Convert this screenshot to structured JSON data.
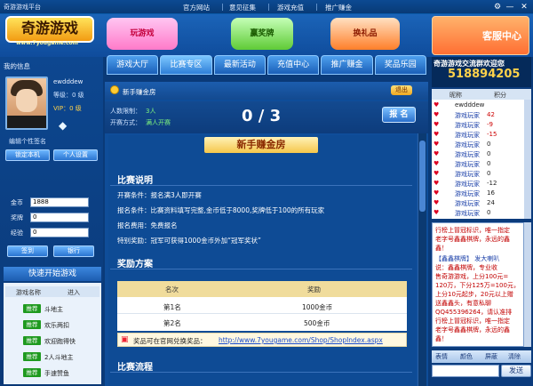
{
  "window": {
    "title": "奇游游戏平台",
    "minimize": "—",
    "close": "✕",
    "gear": "⚙"
  },
  "toplinks": [
    "官方网站",
    "意见征集",
    "游戏充值",
    "推广赚金"
  ],
  "banner": {
    "logo": "奇游游戏",
    "logo_url": "www.7yougame.com",
    "promo1": "玩游戏",
    "promo2": "赢奖牌",
    "promo3": "换礼品",
    "service": "客服中心"
  },
  "nav": [
    "游戏大厅",
    "比赛专区",
    "最新活动",
    "充值中心",
    "推广赚金",
    "奖品乐园"
  ],
  "qq": {
    "title": "奇游游戏交流群欢迎您",
    "number": "518894205"
  },
  "user": {
    "section_title": "我的信息",
    "id": "ewdddew",
    "level": "等级：0 级",
    "vip": "VIP：0 级",
    "signature": "编辑个性签名",
    "lock_btn": "锁定本机",
    "settings_btn": "个人设置",
    "gold_label": "金币",
    "gold": "1888",
    "medal_label": "奖牌",
    "medal": "0",
    "exp_label": "经验",
    "exp": "0",
    "signin_btn": "签到",
    "bank_btn": "银行"
  },
  "quick": {
    "title": "快速开始游戏",
    "head_name": "游戏名称",
    "head_enter": "进入",
    "tag": "推荐",
    "games": [
      "斗地主",
      "欢乐两扣",
      "欢迎跑得快",
      "2人斗地主",
      "手速赞鱼"
    ]
  },
  "room": {
    "name": "新手赚金房",
    "exit": "退出",
    "limit_label": "人数限制：",
    "limit": "3人",
    "mode_label": "开赛方式：",
    "mode": "满人开赛",
    "score": "0 / 3",
    "signup": "报 名",
    "detail_title": "新手赚金房",
    "sec_rules": "比赛说明",
    "rules": [
      "开赛条件：报名满3人即开赛",
      "报名条件：比赛资料填写完整,金币低于8000,奖牌低于100的所有玩家",
      "报名费用：免费报名",
      "特别奖励：冠军可获得1000金币外加“冠军奖状”"
    ],
    "sec_prize": "奖励方案",
    "table_head": [
      "名次",
      "奖励"
    ],
    "table_rows": [
      [
        "第1名",
        "1000金币"
      ],
      [
        "第2名",
        "500金币"
      ]
    ],
    "note_label": "奖品可在官网兑换奖品：",
    "note_link": "http://www.7yougame.com/Shop/ShopIndex.aspx",
    "sec_flow": "比赛流程"
  },
  "rank": {
    "head": [
      "昵称",
      "积分"
    ],
    "rows": [
      [
        "ewdddew",
        ""
      ],
      [
        "游戏玩家",
        "42"
      ],
      [
        "游戏玩家",
        "-9"
      ],
      [
        "游戏玩家",
        "-15"
      ],
      [
        "游戏玩家",
        "0"
      ],
      [
        "游戏玩家",
        "0"
      ],
      [
        "游戏玩家",
        "0"
      ],
      [
        "游戏玩家",
        "0"
      ],
      [
        "游戏玩家",
        "-12"
      ],
      [
        "游戏玩家",
        "16"
      ],
      [
        "游戏玩家",
        "24"
      ],
      [
        "游戏玩家",
        "0"
      ]
    ]
  },
  "chat": {
    "lines": [
      "行榜上冒冠标识，唯一指定",
      "老字号鑫鑫棋牌，永远的鑫",
      "鑫！",
      "【鑫鑫棋牌】 发大喇叭",
      "说：鑫鑫棋牌，专业收",
      "售奇游游戏，上分100元=",
      "120万，下分125万=100元，",
      "上分10元起步，20元以上赠",
      "送鑫鑫头，有意私聊",
      "QQ455396264，请认准排",
      "行榜上冒冠标识，唯一指定",
      "老字号鑫鑫棋牌，永远的鑫",
      "鑫！"
    ],
    "tools": [
      "表情",
      "颜色",
      "屏蔽",
      "清除"
    ],
    "send": "发送"
  }
}
